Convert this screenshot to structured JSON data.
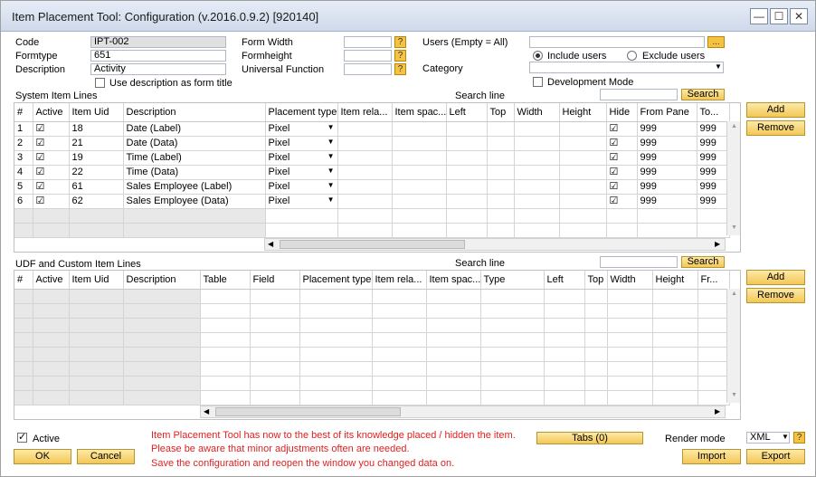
{
  "window": {
    "title": "Item Placement Tool: Configuration (v.2016.0.9.2) [920140]",
    "min_icon": "minimize-icon",
    "max_icon": "maximize-icon",
    "close_icon": "close-icon"
  },
  "form": {
    "code_label": "Code",
    "code_value": "IPT-002",
    "formtype_label": "Formtype",
    "formtype_value": "651",
    "description_label": "Description",
    "description_value": "Activity",
    "use_desc_label": "Use description as form title",
    "form_width_label": "Form Width",
    "form_width_value": "",
    "form_height_label": "Formheight",
    "form_height_value": "",
    "universal_label": "Universal Function",
    "universal_value": "",
    "users_label": "Users (Empty = All)",
    "users_value": "",
    "include_label": "Include users",
    "exclude_label": "Exclude users",
    "category_label": "Category",
    "category_value": "",
    "dev_mode_label": "Development Mode",
    "q": "?",
    "dots": "..."
  },
  "system": {
    "section_label": "System Item Lines",
    "search_label": "Search line",
    "search_button": "Search",
    "add_button": "Add",
    "remove_button": "Remove",
    "columns": [
      "#",
      "Active",
      "Item Uid",
      "Description",
      "Placement type",
      "Item rela...",
      "Item spac...",
      "Left",
      "Top",
      "Width",
      "Height",
      "Hide",
      "From Pane",
      "To..."
    ],
    "rows": [
      {
        "n": "1",
        "uid": "18",
        "desc": "Date (Label)",
        "ptype": "Pixel",
        "from": "999",
        "to": "999"
      },
      {
        "n": "2",
        "uid": "21",
        "desc": "Date (Data)",
        "ptype": "Pixel",
        "from": "999",
        "to": "999"
      },
      {
        "n": "3",
        "uid": "19",
        "desc": "Time (Label)",
        "ptype": "Pixel",
        "from": "999",
        "to": "999"
      },
      {
        "n": "4",
        "uid": "22",
        "desc": "Time (Data)",
        "ptype": "Pixel",
        "from": "999",
        "to": "999"
      },
      {
        "n": "5",
        "uid": "61",
        "desc": "Sales Employee (Label)",
        "ptype": "Pixel",
        "from": "999",
        "to": "999"
      },
      {
        "n": "6",
        "uid": "62",
        "desc": "Sales Employee (Data)",
        "ptype": "Pixel",
        "from": "999",
        "to": "999"
      }
    ]
  },
  "udf": {
    "section_label": "UDF and Custom Item Lines",
    "search_label": "Search line",
    "search_button": "Search",
    "add_button": "Add",
    "remove_button": "Remove",
    "columns": [
      "#",
      "Active",
      "Item Uid",
      "Description",
      "Table",
      "Field",
      "Placement type",
      "Item rela...",
      "Item spac...",
      "Type",
      "Left",
      "Top",
      "Width",
      "Height",
      "Fr..."
    ]
  },
  "footer": {
    "active_label": "Active",
    "ok_button": "OK",
    "cancel_button": "Cancel",
    "msg1": "Item Placement Tool has now to the best of its knowledge placed / hidden the item.",
    "msg2": "Please be aware that minor adjustments often are needed.",
    "msg3": "Save the configuration and reopen the window you changed data on.",
    "tabs_button": "Tabs (0)",
    "render_label": "Render mode",
    "render_value": "XML",
    "import_button": "Import",
    "export_button": "Export"
  },
  "colors": {
    "button": "#f3c756",
    "message": "#e02020",
    "titlebar": "#cfd9ea"
  }
}
